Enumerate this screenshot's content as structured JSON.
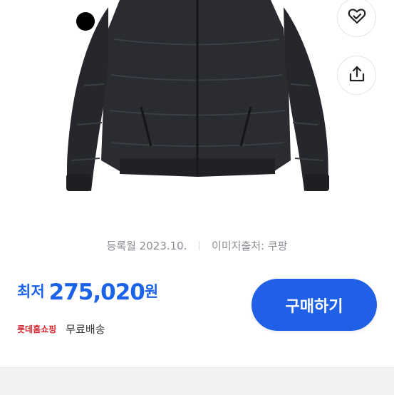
{
  "product": {
    "image_alt": "black padded puffer jacket",
    "registered_label": "등록월 2023.10.",
    "image_source_label": "이미지출처: 쿠팡"
  },
  "price": {
    "label": "최저",
    "value": "275,020",
    "unit": "원",
    "color": "#1a63e8"
  },
  "seller": {
    "name": "롯데홈쇼핑",
    "shipping": "무료배송",
    "name_color": "#d8262f"
  },
  "actions": {
    "buy_label": "구매하기",
    "buy_color": "#1f60e6",
    "wishlist_icon": "heart-check-icon",
    "share_icon": "share-icon"
  },
  "color_options": [
    {
      "name": "black",
      "hex": "#000000"
    }
  ]
}
